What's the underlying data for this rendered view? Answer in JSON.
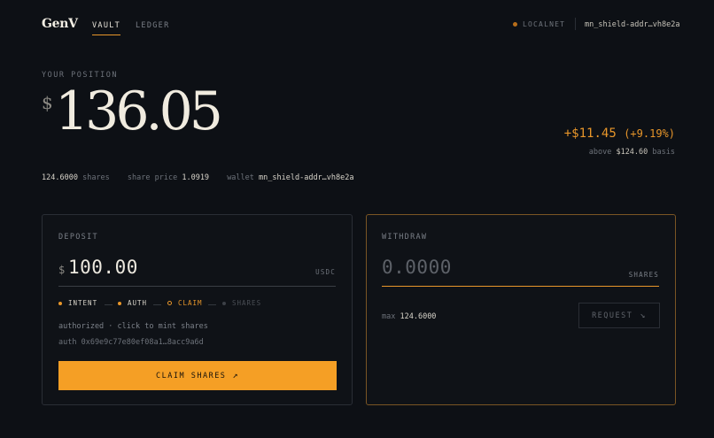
{
  "header": {
    "logo": "GenV",
    "tabs": [
      {
        "label": "VAULT",
        "active": true
      },
      {
        "label": "LEDGER",
        "active": false
      }
    ],
    "network_label": "LOCALNET",
    "wallet_address": "mn_shield-addr…vh8e2a"
  },
  "position": {
    "label": "YOUR POSITION",
    "currency_symbol": "$",
    "amount": "136.05",
    "pnl_value": "+$11.45",
    "pnl_percent": "(+9.19%)",
    "basis_prefix": "above",
    "basis_value": "$124.60",
    "basis_suffix": "basis",
    "shares_value": "124.6000",
    "shares_label": "shares",
    "share_price_label": "share price",
    "share_price_value": "1.0919",
    "wallet_label": "wallet",
    "wallet_value": "mn_shield-addr…vh8e2a"
  },
  "deposit": {
    "title": "DEPOSIT",
    "currency_symbol": "$",
    "amount": "100.00",
    "unit": "USDC",
    "steps": [
      {
        "label": "INTENT",
        "state": "done"
      },
      {
        "label": "AUTH",
        "state": "done"
      },
      {
        "label": "CLAIM",
        "state": "current"
      },
      {
        "label": "SHARES",
        "state": "pending"
      }
    ],
    "status_message": "authorized · click to mint shares",
    "auth_hash": "auth 0x69e9c77e80ef08a1…8acc9a6d",
    "claim_button": "CLAIM SHARES",
    "claim_icon": "arrow-up-right-icon"
  },
  "withdraw": {
    "title": "WITHDRAW",
    "amount_placeholder": "0.0000",
    "unit": "SHARES",
    "max_label": "max",
    "max_value": "124.6000",
    "request_button": "REQUEST",
    "request_icon": "arrow-down-right-icon"
  },
  "colors": {
    "background": "#0d1015",
    "accent": "#f59f25",
    "text": "#e8e4da",
    "muted": "#6d727a"
  }
}
